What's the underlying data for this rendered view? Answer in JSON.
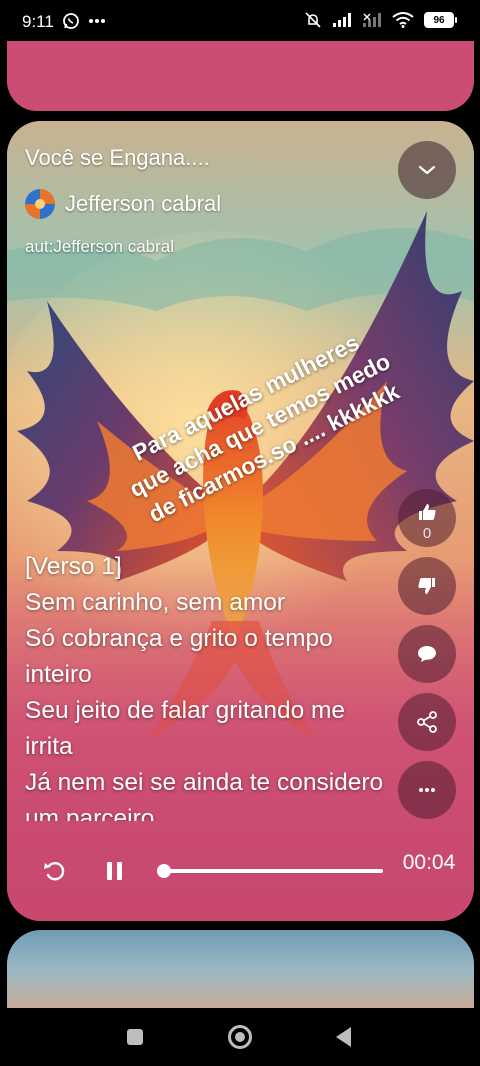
{
  "status_bar": {
    "time": "9:11",
    "battery": "96",
    "icons": [
      "whatsapp-icon",
      "more-dots-icon",
      "mute-icon",
      "signal-icon",
      "signal-icon",
      "wifi-icon",
      "battery-icon"
    ]
  },
  "card": {
    "title": "Você se Engana....",
    "author": "Jefferson cabral",
    "aut_line": "aut:Jefferson cabral",
    "caption": "Para aquelas mulheres que acha que temos medo de ficarmos.so .... kkkkkk",
    "lyrics": [
      "[Verso 1]",
      "Sem carinho, sem amor",
      "Só cobrança e grito o tempo inteiro",
      "Seu jeito de falar gritando me irrita",
      "Já nem sei se ainda te considero um parceiro"
    ],
    "like_count": "0",
    "player": {
      "time": "00:04",
      "progress": 0.0
    }
  },
  "colors": {
    "accent": "#c94a73",
    "card_bg": "#cc4d74"
  }
}
